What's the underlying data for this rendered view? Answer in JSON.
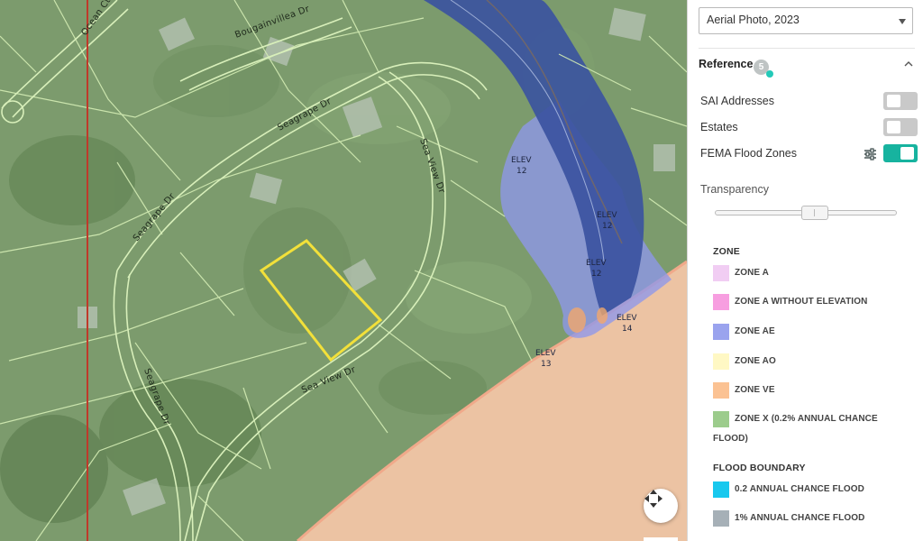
{
  "map": {
    "roads": [
      "Ocean Ct",
      "Bougainvillea Dr",
      "Seagrape Dr",
      "Seagrape Dr",
      "Sea View Dr",
      "Sea View Dr",
      "Seagrape Dr"
    ],
    "elevations": [
      {
        "label": "ELEV",
        "value": "12"
      },
      {
        "label": "ELEV",
        "value": "12"
      },
      {
        "label": "ELEV",
        "value": "12"
      },
      {
        "label": "ELEV",
        "value": "14"
      },
      {
        "label": "ELEV",
        "value": "13"
      }
    ],
    "recenter_icon": "arrows-move-icon"
  },
  "basemap": {
    "selected": "Aerial Photo, 2023"
  },
  "reference": {
    "title": "Reference",
    "count": "5",
    "layers": [
      {
        "label": "SAI Addresses",
        "on": false
      },
      {
        "label": "Estates",
        "on": false
      },
      {
        "label": "FEMA Flood Zones",
        "on": true
      }
    ],
    "transparency_label": "Transparency",
    "transparency_value": 0.55
  },
  "legend": {
    "zone_heading": "ZONE",
    "zones": [
      {
        "label": "ZONE A",
        "color": "#f1cdf3"
      },
      {
        "label": "ZONE A WITHOUT ELEVATION",
        "color": "#f79ee0"
      },
      {
        "label": "ZONE AE",
        "color": "#9aa3ee"
      },
      {
        "label": "ZONE AO",
        "color": "#fff8c4"
      },
      {
        "label": "ZONE VE",
        "color": "#fbc293"
      },
      {
        "label": "ZONE X (0.2% ANNUAL CHANCE FLOOD)",
        "color": "#9ccc8c"
      }
    ],
    "boundary_heading": "FLOOD BOUNDARY",
    "boundaries": [
      {
        "label": "0.2 ANNUAL CHANCE FLOOD",
        "color": "#18c8ee"
      },
      {
        "label": "1% ANNUAL CHANCE FLOOD",
        "color": "#a6b0b7"
      }
    ]
  }
}
